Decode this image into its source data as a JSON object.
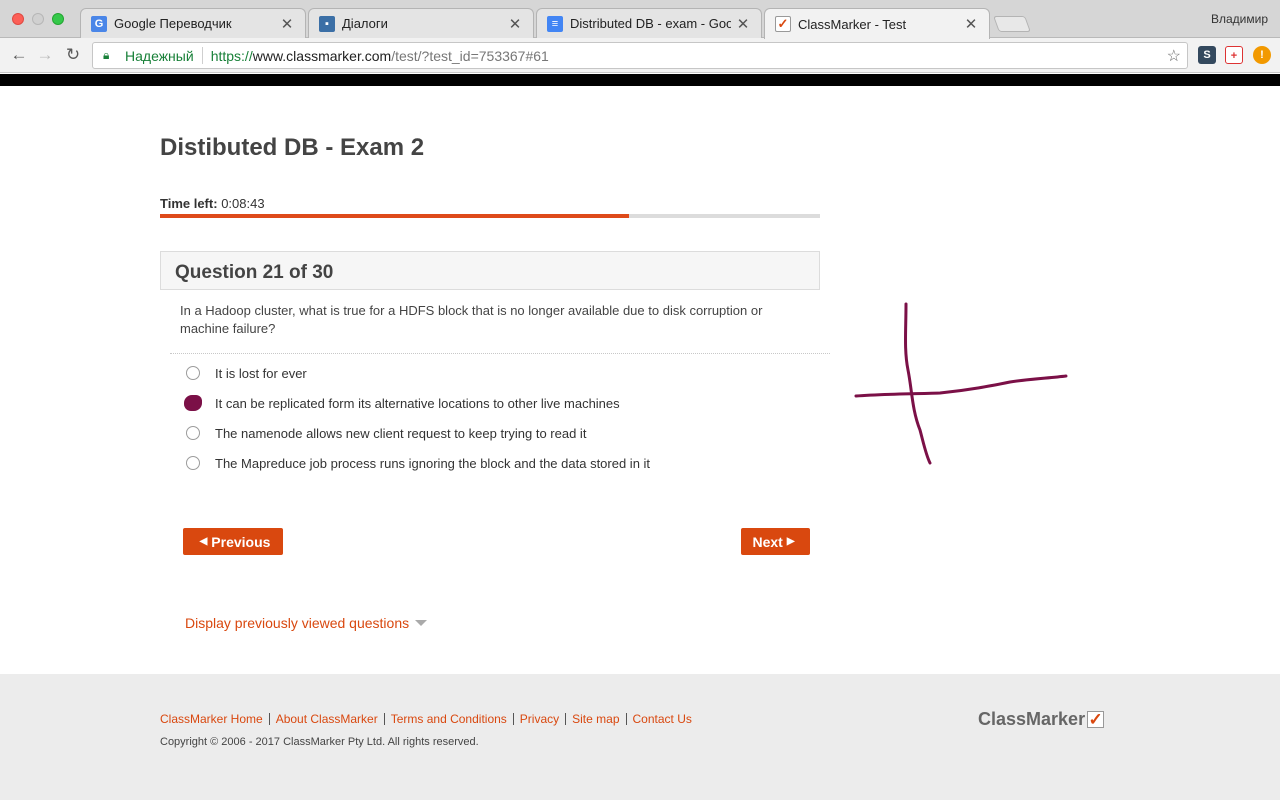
{
  "browser": {
    "profile_name": "Владимир",
    "tabs": [
      {
        "title": "Google Переводчик",
        "icon": "google-translate-icon",
        "active": false
      },
      {
        "title": "Діалоги",
        "icon": "chat-icon",
        "active": false
      },
      {
        "title": "Distributed DB - exam - Googl",
        "icon": "docs-icon",
        "active": false
      },
      {
        "title": "ClassMarker - Test",
        "icon": "classmarker-icon",
        "active": true
      }
    ],
    "security_label": "Надежный",
    "url": {
      "scheme": "https://",
      "host": "www.classmarker.com",
      "path": "/test/?test_id=753367#61"
    }
  },
  "exam": {
    "title": "Distibuted DB - Exam 2",
    "time_left_label": "Time left:",
    "time_left_value": "0:08:43",
    "progress_fraction": 0.71
  },
  "question": {
    "header": "Question 21 of 30",
    "text": "In a Hadoop cluster, what is true for a HDFS block that is no longer available due to disk corruption or machine failure?",
    "options": [
      {
        "label": "It is lost for ever",
        "selected": false
      },
      {
        "label": "It can be replicated form its alternative locations to other live machines",
        "selected": true
      },
      {
        "label": "The namenode allows new client request to keep trying to read it",
        "selected": false
      },
      {
        "label": "The Mapreduce job process runs ignoring the block and the data stored in it",
        "selected": false
      }
    ]
  },
  "nav": {
    "previous_label": "Previous",
    "next_label": "Next",
    "display_previous_label": "Display previously viewed questions"
  },
  "footer": {
    "links": [
      "ClassMarker Home",
      "About ClassMarker",
      "Terms and Conditions",
      "Privacy",
      "Site map",
      "Contact Us"
    ],
    "copyright": "Copyright © 2006 - 2017 ClassMarker Pty Ltd. All rights reserved.",
    "logo_text": "ClassMarker"
  },
  "colors": {
    "accent": "#d9480f",
    "annotation": "#7b1047"
  }
}
